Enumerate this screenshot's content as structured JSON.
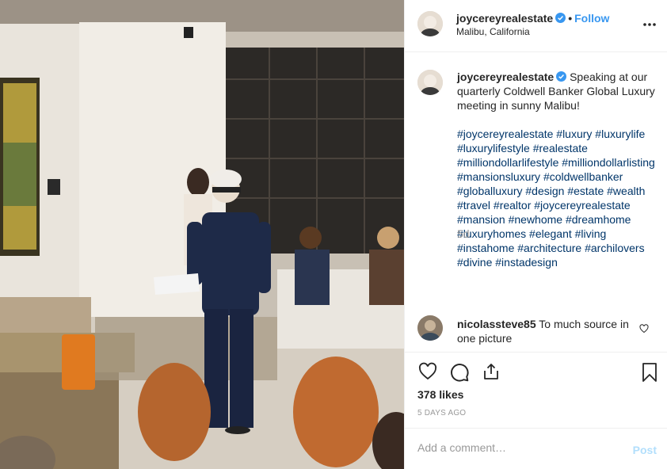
{
  "post": {
    "username": "joycereyrealestate",
    "follow_label": "Follow",
    "separator": "•",
    "location": "Malibu, California",
    "more_label": "•••",
    "caption": "Speaking at our quarterly Coldwell Banker Global Luxury meeting in sunny Malibu!",
    "hashtags": "#joycereyrealestate #luxury #luxurylife #luxurylifestyle #realestate #milliondollarlifestyle #milliondollarlisting #mansionsluxury #coldwellbanker #globalluxury #design #estate #wealth #travel #realtor #joycereyrealestate #mansion #newhome #dreamhome #luxuryhomes #elegant #living #instahome #architecture #archilovers #divine #instadesign",
    "time_ago": "5d",
    "likes": "378 likes",
    "date": "5 DAYS AGO"
  },
  "comments": [
    {
      "username": "nicolassteve85",
      "text": "To much source in one picture"
    }
  ],
  "add_comment": {
    "placeholder": "Add a comment…",
    "post_label": "Post"
  },
  "icons": {
    "verified": "verified-badge-icon",
    "more": "more-options-icon",
    "like": "heart-icon",
    "comment": "comment-bubble-icon",
    "share": "share-icon",
    "save": "bookmark-icon"
  },
  "colors": {
    "link": "#3897f0",
    "hashtag": "#003569",
    "muted": "#999999",
    "post_disabled": "#b2dffc"
  }
}
